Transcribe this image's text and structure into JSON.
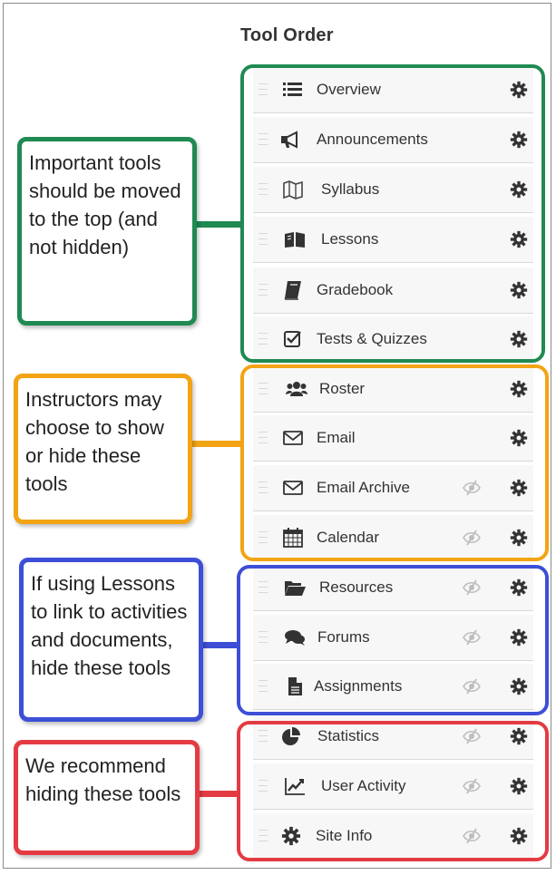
{
  "title": "Tool Order",
  "colors": {
    "green": "#1f8a52",
    "orange": "#f2a414",
    "blue": "#3d4fd6",
    "red": "#e43b43"
  },
  "callouts": {
    "important": "Important tools should be moved to the top (and not hidden)",
    "instructors": "Instructors may choose to show or hide these tools",
    "lessons": "If using Lessons to link to activities and documents, hide these tools",
    "recommend": "We recommend hiding these tools"
  },
  "tools": [
    {
      "label": "Overview",
      "icon": "list-icon",
      "hide": false
    },
    {
      "label": "Announcements",
      "icon": "megaphone-icon",
      "hide": false
    },
    {
      "label": "Syllabus",
      "icon": "map-icon",
      "hide": false
    },
    {
      "label": "Lessons",
      "icon": "book-open-icon",
      "hide": false
    },
    {
      "label": "Gradebook",
      "icon": "book-icon",
      "hide": false
    },
    {
      "label": "Tests & Quizzes",
      "icon": "checkbox-icon",
      "hide": false
    },
    {
      "label": "Roster",
      "icon": "users-icon",
      "hide": false
    },
    {
      "label": "Email",
      "icon": "envelope-icon",
      "hide": false
    },
    {
      "label": "Email Archive",
      "icon": "envelope-icon",
      "hide": true
    },
    {
      "label": "Calendar",
      "icon": "calendar-icon",
      "hide": true
    },
    {
      "label": "Resources",
      "icon": "folder-open-icon",
      "hide": true
    },
    {
      "label": "Forums",
      "icon": "comments-icon",
      "hide": true
    },
    {
      "label": "Assignments",
      "icon": "file-icon",
      "hide": true
    },
    {
      "label": "Statistics",
      "icon": "pie-chart-icon",
      "hide": true
    },
    {
      "label": "User Activity",
      "icon": "line-chart-icon",
      "hide": true
    },
    {
      "label": "Site Info",
      "icon": "gear-icon",
      "hide": true
    }
  ]
}
